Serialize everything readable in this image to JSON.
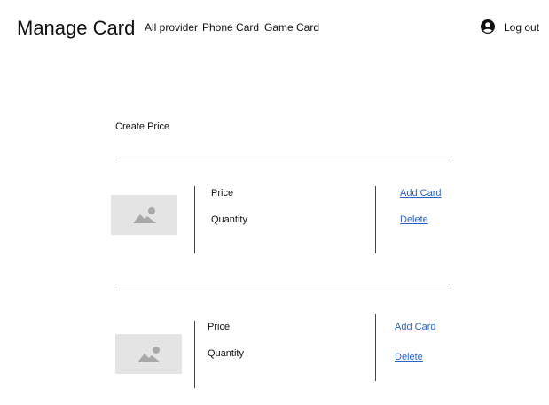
{
  "header": {
    "title": "Manage Card",
    "nav": [
      "All provider",
      "Phone Card",
      "Game Card"
    ],
    "user_icon": "user-circle-icon",
    "logout_label": "Log out"
  },
  "main": {
    "section_title": "Create Price",
    "cards": [
      {
        "image_icon": "image-placeholder-icon",
        "price_label": "Price",
        "quantity_label": "Quantity",
        "add_label": "Add Card",
        "delete_label": "Delete"
      },
      {
        "image_icon": "image-placeholder-icon",
        "price_label": "Price",
        "quantity_label": "Quantity",
        "add_label": "Add Card",
        "delete_label": "Delete"
      }
    ]
  },
  "colors": {
    "link": "#2a63c9",
    "placeholder_bg": "#e4e4e4",
    "placeholder_icon": "#a8a8a8",
    "divider": "#444444"
  }
}
